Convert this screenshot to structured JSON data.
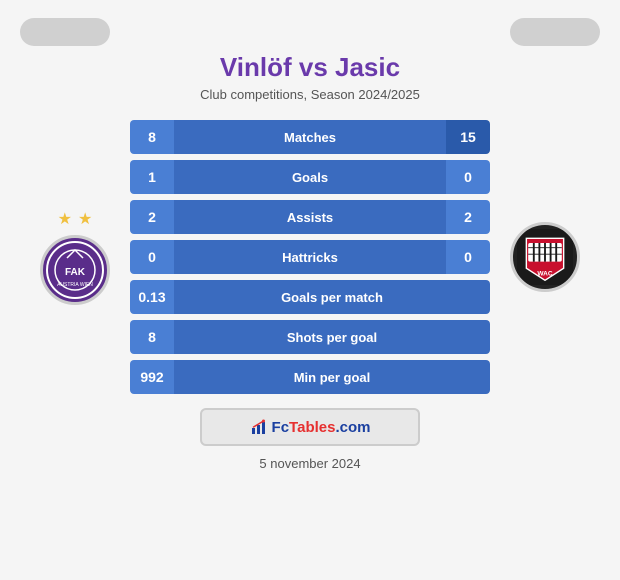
{
  "title": "Vinlöf vs Jasic",
  "subtitle": "Club competitions, Season 2024/2025",
  "stats": [
    {
      "label": "Matches",
      "left": "8",
      "right": "15",
      "single": false
    },
    {
      "label": "Goals",
      "left": "1",
      "right": "0",
      "single": false
    },
    {
      "label": "Assists",
      "left": "2",
      "right": "2",
      "single": false
    },
    {
      "label": "Hattricks",
      "left": "0",
      "right": "0",
      "single": false
    },
    {
      "label": "Goals per match",
      "left": "0.13",
      "right": null,
      "single": true
    },
    {
      "label": "Shots per goal",
      "left": "8",
      "right": null,
      "single": true
    },
    {
      "label": "Min per goal",
      "left": "992",
      "right": null,
      "single": true
    }
  ],
  "footer_logo_text": "FcTables.com",
  "footer_date": "5 november 2024",
  "left_team_stars": [
    "★",
    "★"
  ],
  "brand": {
    "primary_color": "#6a3aab",
    "bar_color": "#4a7fd4",
    "bar_dark": "#2a5aaa"
  }
}
